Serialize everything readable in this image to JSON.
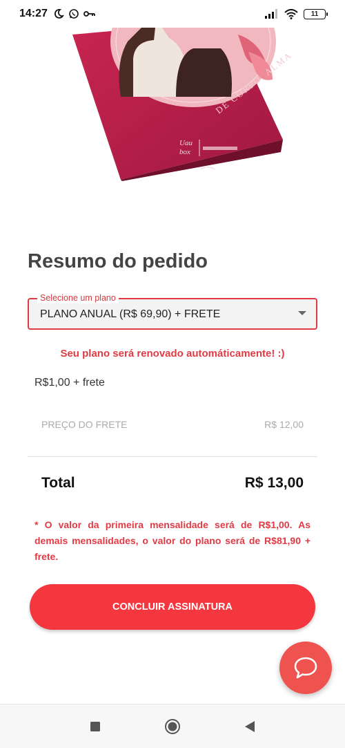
{
  "status_bar": {
    "time": "14:27",
    "battery": "11",
    "icons": [
      "moon-icon",
      "whatsapp-icon",
      "key-icon",
      "signal-icon",
      "wifi-icon",
      "battery-icon"
    ]
  },
  "order_summary": {
    "title": "Resumo do pedido",
    "plan_select": {
      "label": "Selecione um plano",
      "value": "PLANO ANUAL (R$ 69,90) + FRETE"
    },
    "renew_note": "Seu plano será renovado automáticamente! :)",
    "price_line": "R$1,00 + frete",
    "shipping_label": "PREÇO DO FRETE",
    "shipping_value": "R$ 12,00",
    "total_label": "Total",
    "total_value": "R$ 13,00",
    "footnote": "* O valor da primeira mensalidade será de R$1,00. As demais mensalidades, o valor do plano será de R$81,90 + frete.",
    "cta_label": "CONCLUIR ASSINATURA"
  },
  "colors": {
    "accent": "#e03b45",
    "button": "#f4363f",
    "chat_fab": "#ef5350"
  },
  "nav_icons": [
    "recents-icon",
    "home-icon",
    "back-icon"
  ]
}
